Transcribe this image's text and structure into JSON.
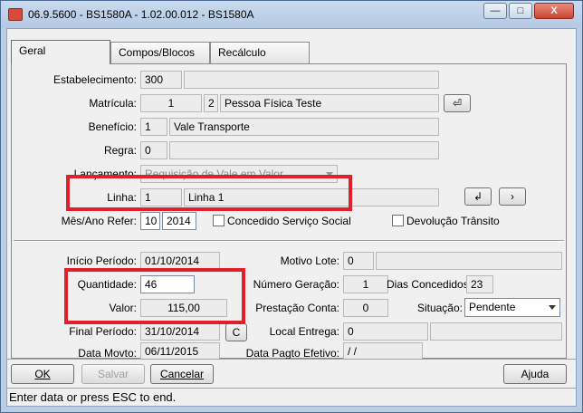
{
  "window": {
    "title": "06.9.5600 - BS1580A - 1.02.00.012 - BS1580A",
    "buttons": {
      "minimize": "—",
      "maximize": "□",
      "close": "X"
    }
  },
  "tabs": [
    {
      "label": "Geral"
    },
    {
      "label": "Compos/Blocos"
    },
    {
      "label": "Recálculo"
    }
  ],
  "form": {
    "estabelecimento": {
      "label": "Estabelecimento:",
      "value": "300",
      "desc": ""
    },
    "matricula": {
      "label": "Matrícula:",
      "value": "1",
      "seq": "2",
      "name": "Pessoa Física Teste"
    },
    "beneficio": {
      "label": "Benefício:",
      "value": "1",
      "desc": "Vale Transporte"
    },
    "regra": {
      "label": "Regra:",
      "value": "0",
      "desc": ""
    },
    "lancamento": {
      "label": "Lançamento:",
      "value": "Requisição de Vale em Valor"
    },
    "linha": {
      "label": "Linha:",
      "value": "1",
      "desc": "Linha 1"
    },
    "mes_ano_refer": {
      "label": "Mês/Ano Refer:",
      "month": "10",
      "year": "2014"
    },
    "concedido_servico_social": {
      "label": "Concedido Serviço Social",
      "checked": false
    },
    "devolucao_transito": {
      "label": "Devolução Trânsito",
      "checked": false
    },
    "inicio_periodo": {
      "label": "Início Período:",
      "value": "01/10/2014"
    },
    "quantidade": {
      "label": "Quantidade:",
      "value": "46"
    },
    "valor": {
      "label": "Valor:",
      "value": "115,00"
    },
    "final_periodo": {
      "label": "Final Período:",
      "value": "31/10/2014",
      "button": "C"
    },
    "data_movto": {
      "label": "Data Movto:",
      "value": "06/11/2015"
    },
    "motivo_lote": {
      "label": "Motivo Lote:",
      "value": "0",
      "desc": ""
    },
    "numero_geracao": {
      "label": "Número Geração:",
      "value": "1"
    },
    "dias_concedidos": {
      "label": "Dias Concedidos:",
      "value": "23"
    },
    "prestacao_conta": {
      "label": "Prestação Conta:",
      "value": "0"
    },
    "situacao": {
      "label": "Situação:",
      "value": "Pendente"
    },
    "local_entrega": {
      "label": "Local Entrega:",
      "value": "0",
      "desc": ""
    },
    "data_pagto_efetivo": {
      "label": "Data Pagto Efetivo:",
      "value": "/ /"
    }
  },
  "actions": {
    "ok": "OK",
    "salvar": "Salvar",
    "cancelar": "Cancelar",
    "ajuda": "Ajuda"
  },
  "status_text": "Enter data or press ESC to end.",
  "colors": {
    "highlight_box": "#e0202a"
  }
}
